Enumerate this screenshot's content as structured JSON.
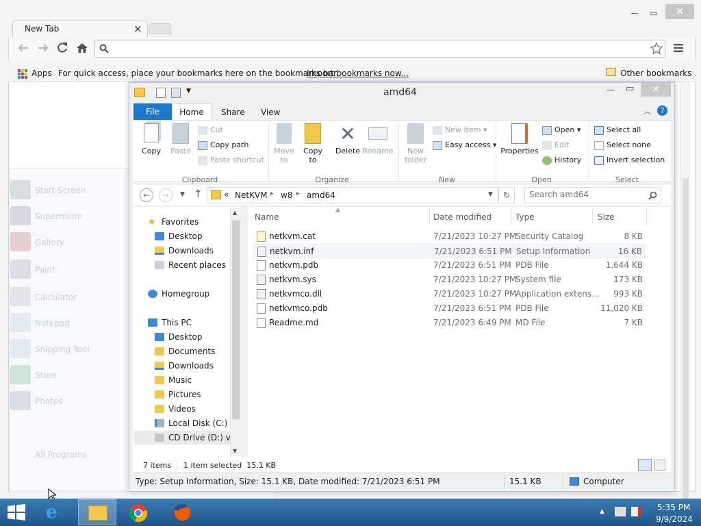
{
  "chrome": {
    "tab_title": "New Tab",
    "tab_close": "×",
    "window_controls": {
      "minimize": "—",
      "maximize": "▭",
      "close": "✕"
    },
    "omnibox_value": "",
    "apps_label": "Apps",
    "bookmarks_hint": "For quick access, place your bookmarks here on the bookmarks bar.",
    "import_link": "Import bookmarks now...",
    "other_bookmarks": "Other bookmarks"
  },
  "start_menu_ghost": [
    "Start Screen",
    "Supermium",
    "Gallery",
    "Paint",
    "Calculator",
    "Notepad",
    "Snipping Tool",
    "Store",
    "Photos",
    "All Programs"
  ],
  "explorer": {
    "title": "amd64",
    "ribbon_tabs": [
      "File",
      "Home",
      "Share",
      "View"
    ],
    "clipboard": {
      "label": "Clipboard",
      "copy": "Copy",
      "paste": "Paste",
      "cut": "Cut",
      "copy_path": "Copy path",
      "paste_shortcut": "Paste shortcut"
    },
    "organize": {
      "label": "Organize",
      "move_to": "Move to",
      "copy_to": "Copy to",
      "delete": "Delete",
      "rename": "Rename"
    },
    "new": {
      "label": "New",
      "new_folder": "New folder",
      "new_item": "New item",
      "easy_access": "Easy access"
    },
    "open": {
      "label": "Open",
      "properties": "Properties",
      "open": "Open",
      "edit": "Edit",
      "history": "History"
    },
    "select": {
      "label": "Select",
      "select_all": "Select all",
      "select_none": "Select none",
      "invert_selection": "Invert selection"
    },
    "address": {
      "prefix": "«",
      "crumbs": [
        "NetKVM",
        "w8",
        "amd64"
      ],
      "search_placeholder": "Search amd64"
    },
    "nav": {
      "favorites": "Favorites",
      "favorites_items": [
        "Desktop",
        "Downloads",
        "Recent places"
      ],
      "homegroup": "Homegroup",
      "this_pc": "This PC",
      "pc_items": [
        "Desktop",
        "Documents",
        "Downloads",
        "Music",
        "Pictures",
        "Videos",
        "Local Disk (C:)",
        "CD Drive (D:) virt"
      ]
    },
    "columns": {
      "name": "Name",
      "date": "Date modified",
      "type": "Type",
      "size": "Size"
    },
    "files": [
      {
        "name": "netkvm.cat",
        "date": "7/21/2023 10:27 PM",
        "type": "Security Catalog",
        "size": "8 KB"
      },
      {
        "name": "netkvm.inf",
        "date": "7/21/2023 6:51 PM",
        "type": "Setup Information",
        "size": "16 KB"
      },
      {
        "name": "netkvm.pdb",
        "date": "7/21/2023 6:51 PM",
        "type": "PDB File",
        "size": "1,644 KB"
      },
      {
        "name": "netkvm.sys",
        "date": "7/21/2023 10:27 PM",
        "type": "System file",
        "size": "173 KB"
      },
      {
        "name": "netkvmco.dll",
        "date": "7/21/2023 10:27 PM",
        "type": "Application extens...",
        "size": "993 KB"
      },
      {
        "name": "netkvmco.pdb",
        "date": "7/21/2023 6:51 PM",
        "type": "PDB File",
        "size": "11,020 KB"
      },
      {
        "name": "Readme.md",
        "date": "7/21/2023 6:49 PM",
        "type": "MD File",
        "size": "7 KB"
      }
    ],
    "status": {
      "items": "7 items",
      "selected": "1 item selected  15.1 KB"
    },
    "window_status": {
      "info": "Type: Setup Information, Size: 15.1 KB, Date modified: 7/21/2023 6:51 PM",
      "size": "15.1 KB",
      "location": "Computer"
    }
  },
  "taskbar": {
    "time": "5:35 PM",
    "date": "9/9/2024"
  },
  "colors": {
    "file_tab": "#1979ca",
    "taskbar": "#2b6aa1",
    "selection": "#f2f6fb"
  }
}
